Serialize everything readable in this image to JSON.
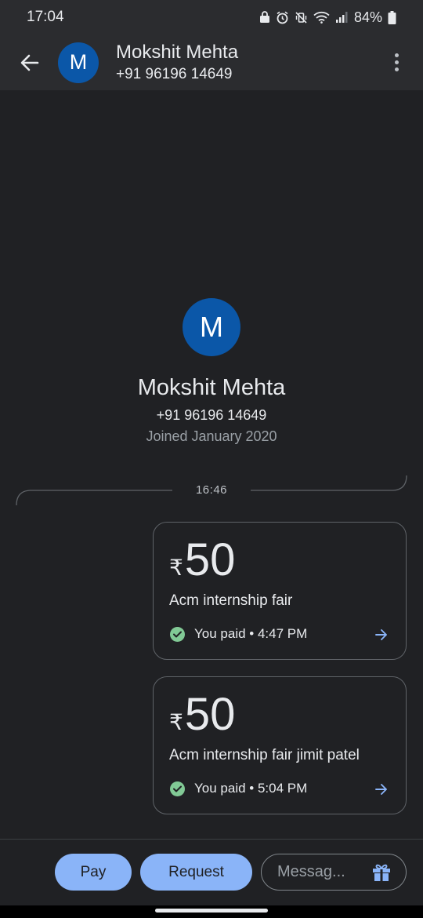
{
  "status_bar": {
    "time": "17:04",
    "battery": "84%"
  },
  "header": {
    "avatar_letter": "M",
    "name": "Mokshit Mehta",
    "phone": "+91 96196 14649"
  },
  "profile": {
    "avatar_letter": "M",
    "name": "Mokshit Mehta",
    "phone": "+91 96196 14649",
    "joined": "Joined January 2020"
  },
  "timeline": {
    "time": "16:46"
  },
  "transactions": [
    {
      "currency": "₹",
      "amount": "50",
      "note": "Acm internship fair",
      "status": "You paid • 4:47 PM"
    },
    {
      "currency": "₹",
      "amount": "50",
      "note": "Acm internship fair jimit patel",
      "status": "You paid • 5:04 PM"
    }
  ],
  "bottom_bar": {
    "pay_label": "Pay",
    "request_label": "Request",
    "message_placeholder": "Messag..."
  },
  "colors": {
    "background": "#202124",
    "avatar": "#0b57a8",
    "accent": "#8ab4f8",
    "success": "#81c995"
  }
}
